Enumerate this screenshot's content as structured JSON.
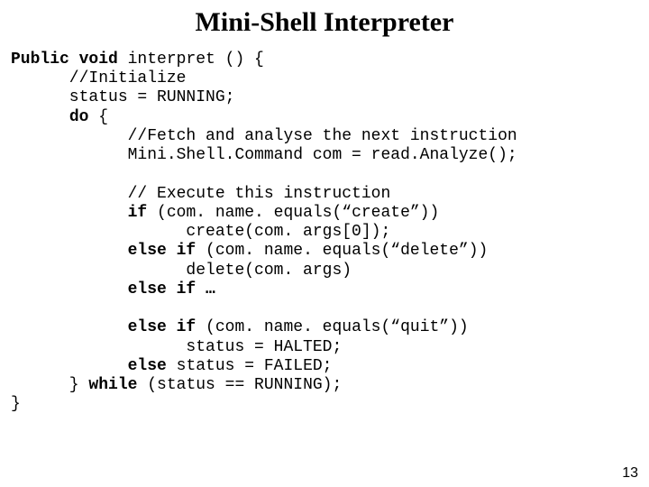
{
  "title": "Mini-Shell Interpreter",
  "code": {
    "l1a": "Public void",
    "l1b": " interpret () {",
    "l2": "      //Initialize",
    "l3": "      status = RUNNING;",
    "l4a": "      ",
    "l4b": "do",
    "l4c": " {",
    "l5": "            //Fetch and analyse the next instruction",
    "l6": "            Mini.Shell.Command com = read.Analyze();",
    "l7": "",
    "l8": "            // Execute this instruction",
    "l9a": "            ",
    "l9b": "if",
    "l9c": " (com. name. equals(“create”))",
    "l10": "                  create(com. args[0]);",
    "l11a": "            ",
    "l11b": "else if",
    "l11c": " (com. name. equals(“delete”))",
    "l12": "                  delete(com. args)",
    "l13a": "            ",
    "l13b": "else if …",
    "l14": "",
    "l15a": "            ",
    "l15b": "else if",
    "l15c": " (com. name. equals(“quit”))",
    "l16": "                  status = HALTED;",
    "l17a": "            ",
    "l17b": "else",
    "l17c": " status = FAILED;",
    "l18a": "      } ",
    "l18b": "while",
    "l18c": " (status == RUNNING);",
    "l19": "}"
  },
  "page_number": "13"
}
